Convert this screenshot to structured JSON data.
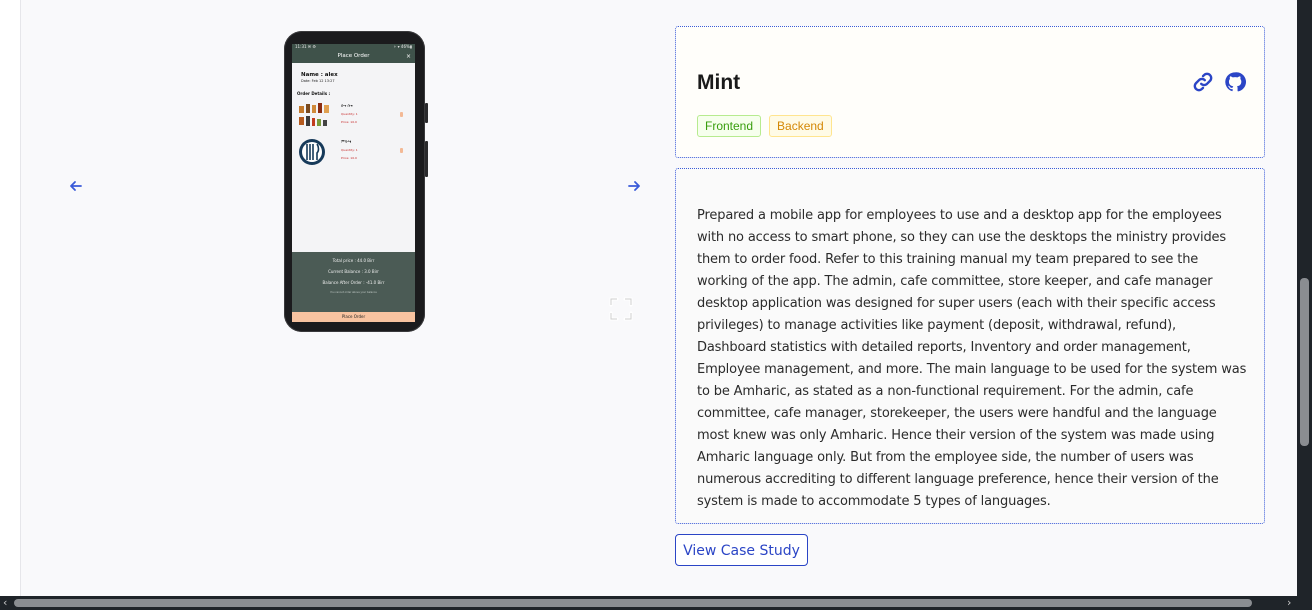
{
  "project": {
    "title": "Mint",
    "tags": [
      {
        "label": "Frontend",
        "color": "#389e0d"
      },
      {
        "label": "Backend",
        "color": "#d48806"
      }
    ],
    "description": "Prepared a mobile app for employees to use and a desktop app for the employees with no access to smart phone, so they can use the desktops the ministry provides them to order food. Refer to this training manual my team prepared to see the working of the app. The admin, cafe committee, store keeper, and cafe manager desktop application was designed for super users (each with their specific access privileges) to manage activities like payment (deposit, withdrawal, refund), Dashboard statistics with detailed reports, Inventory and order management, Employee management, and more. The main language to be used for the system was to be Amharic, as stated as a non-functional requirement. For the admin, cafe committee, cafe manager, storekeeper, the users were handful and the language most knew was only Amharic. Hence their version of the system was made using Amharic language only. But from the employee side, the number of users was numerous accrediting to different language preference, hence their version of the system is made to accommodate 5 types of languages.",
    "case_study_label": "View Case Study",
    "icons": [
      "link-icon",
      "github-icon"
    ]
  },
  "carousel": {
    "prev_icon": "arrow-left-icon",
    "next_icon": "arrow-right-icon",
    "expand_icon": "expand-icon"
  },
  "phone_screen": {
    "status_left": "11:31 ✉ ⚙",
    "status_right": "⚬ ▾ 46%▮",
    "app_bar_title": "Place Order",
    "close": "×",
    "name": "Name : alex",
    "date": "Date: Feb 12 13:27",
    "order_details": "Order Details :",
    "items": [
      {
        "name": "ቡና ቡና",
        "quantity": "Quantity: 1",
        "price": "Price: 10.0"
      },
      {
        "name": "ምሳሃፃ",
        "quantity": "Quantity: 1",
        "price": "Price: 10.0"
      }
    ],
    "total_price": "Total price : 44.0 Birr",
    "current_balance": "Current Balance : 3.0 Birr",
    "balance_after": "Balance After Order : -41.0 Birr",
    "fine_print": "You cannot order above your balance",
    "place_order": "Place Order"
  },
  "colors": {
    "accent": "#3a5bd9",
    "button": "#2b45c6",
    "app_bar": "#3f524a",
    "summary": "#4b5b55",
    "place_order": "#f8c3a0"
  }
}
